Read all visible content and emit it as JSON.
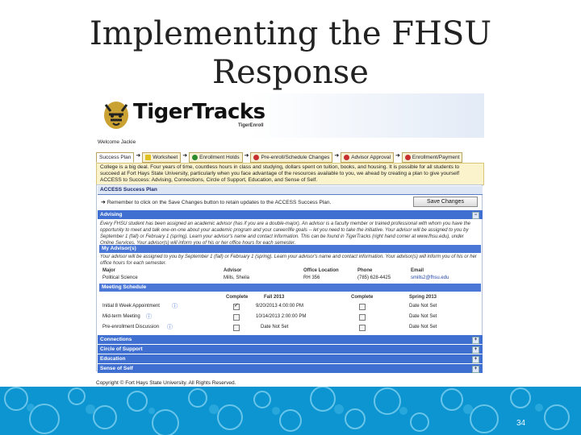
{
  "slide": {
    "title_line1": "Implementing the FHSU",
    "title_line2": "Response",
    "page_number": "34"
  },
  "app": {
    "brand": "TigerTracks",
    "brand_sub": "TigerEnroll",
    "welcome": "Welcome Jackie"
  },
  "tabs": [
    {
      "label": "Success Plan",
      "icon": ""
    },
    {
      "label": "Worksheet",
      "icon": "warning-icon"
    },
    {
      "label": "Enrollment Holds",
      "icon": "check-icon"
    },
    {
      "label": "Pre-enroll/Schedule Changes",
      "icon": "blocked-icon"
    },
    {
      "label": "Advisor Approval",
      "icon": "blocked-icon"
    },
    {
      "label": "Enrollment/Payment",
      "icon": "blocked-icon"
    }
  ],
  "intro": "College is a big deal. Four years of time, countless hours in class and studying, dollars spent on tuition, books, and housing. It is possible for all students to succeed at Fort Hays State University, particularly when you face advantage of the resources available to you, we ahead by creating a plan to give yourself ACCESS to Success: Advising, Connections, Circle of Support, Education, and Sense of Self.",
  "plan": {
    "header": "ACCESS Success Plan",
    "remember": "Remember to click on the Save Changes button to retain updates to the ACCESS Success Plan.",
    "save_label": "Save Changes"
  },
  "advising": {
    "label": "Advising",
    "text": "Every FHSU student has been assigned an academic advisor (has if you are a double-major). An advisor is a faculty member or trained professional with whom you have the opportunity to meet and talk one-on-one about your academic program and your career/life goals -- let you need to take the initiative. Your advisor will be assigned to you by September 1 (fall) or February 1 (spring). Learn your advisor's name and contact information. This can be found in TigerTracks (right hand corner at www.fhsu.edu), under Online Services. Your advisor(s) will inform you of his or her office hours for each semester.",
    "my_advisors_label": "My Advisor(s)",
    "my_advisors_text": "Your advisor will be assigned to you by September 1 (fall) or February 1 (spring). Learn your advisor's name and contact information. Your advisor(s) will inform you of his or her office hours for each semester.",
    "columns": [
      "Major",
      "Advisor",
      "Office Location",
      "Phone",
      "Email"
    ],
    "row": [
      "Political Science",
      "Mills, Sheila",
      "RH 356",
      "(785) 628-4425",
      "smills2@fhsu.edu"
    ]
  },
  "meetings": {
    "label": "Meeting Schedule",
    "columns": [
      "Complete",
      "Fall 2013",
      "Complete",
      "Spring 2013"
    ],
    "rows": [
      {
        "name": "Initial 8 Week Appointment",
        "fall_done": true,
        "fall": "9/20/2013 4:00:00 PM",
        "spring_done": false,
        "spring": "Date Not Set"
      },
      {
        "name": "Mid-term Meeting",
        "fall_done": false,
        "fall": "10/14/2013 2:00:00 PM",
        "spring_done": false,
        "spring": "Date Not Set"
      },
      {
        "name": "Pre-enrollment Discussion",
        "fall_done": false,
        "fall": "Date Not Set",
        "spring_done": false,
        "spring": "Date Not Set"
      }
    ]
  },
  "sections": [
    "Connections",
    "Circle of Support",
    "Education",
    "Sense of Self"
  ],
  "copyright": "Copyright © Fort Hays State University. All Rights Reserved."
}
